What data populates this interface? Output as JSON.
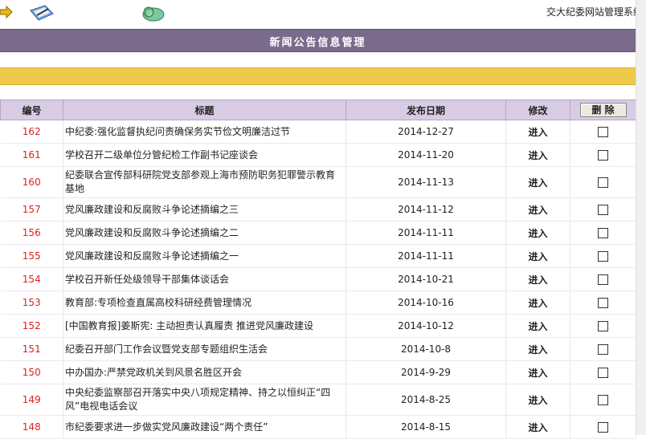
{
  "header": {
    "app_title": "交大纪委网站管理系统",
    "icons": [
      "arrow-icon",
      "notebook-pen-icon",
      "mail-globe-icon"
    ]
  },
  "section": {
    "title": "新闻公告信息管理"
  },
  "table": {
    "columns": {
      "id": "编号",
      "title": "标题",
      "date": "发布日期",
      "edit": "修改",
      "delete": "删 除"
    },
    "edit_label": "进入",
    "rows": [
      {
        "id": "162",
        "title": "中纪委:强化监督执纪问责确保务实节俭文明廉洁过节",
        "date": "2014-12-27"
      },
      {
        "id": "161",
        "title": "学校召开二级单位分管纪检工作副书记座谈会",
        "date": "2014-11-20"
      },
      {
        "id": "160",
        "title": "纪委联合宣传部科研院党支部参观上海市预防职务犯罪警示教育基地",
        "date": "2014-11-13"
      },
      {
        "id": "157",
        "title": "党风廉政建设和反腐败斗争论述摘编之三",
        "date": "2014-11-12"
      },
      {
        "id": "156",
        "title": "党风廉政建设和反腐败斗争论述摘编之二",
        "date": "2014-11-11"
      },
      {
        "id": "155",
        "title": "党风廉政建设和反腐败斗争论述摘编之一",
        "date": "2014-11-11"
      },
      {
        "id": "154",
        "title": "学校召开新任处级领导干部集体谈话会",
        "date": "2014-10-21"
      },
      {
        "id": "153",
        "title": "教育部:专项检查直属高校科研经费管理情况",
        "date": "2014-10-16"
      },
      {
        "id": "152",
        "title": "[中国教育报]姜斯宪: 主动担责认真履责 推进党风廉政建设",
        "date": "2014-10-12"
      },
      {
        "id": "151",
        "title": "纪委召开部门工作会议暨党支部专题组织生活会",
        "date": "2014-10-8"
      },
      {
        "id": "150",
        "title": "中办国办:严禁党政机关到风景名胜区开会",
        "date": "2014-9-29"
      },
      {
        "id": "149",
        "title": "中央纪委监察部召开落实中央八项规定精神、持之以恒纠正“四风”电视电话会议",
        "date": "2014-8-25"
      },
      {
        "id": "148",
        "title": "市纪委要求进一步做实党风廉政建设“两个责任”",
        "date": "2014-8-15"
      }
    ]
  }
}
